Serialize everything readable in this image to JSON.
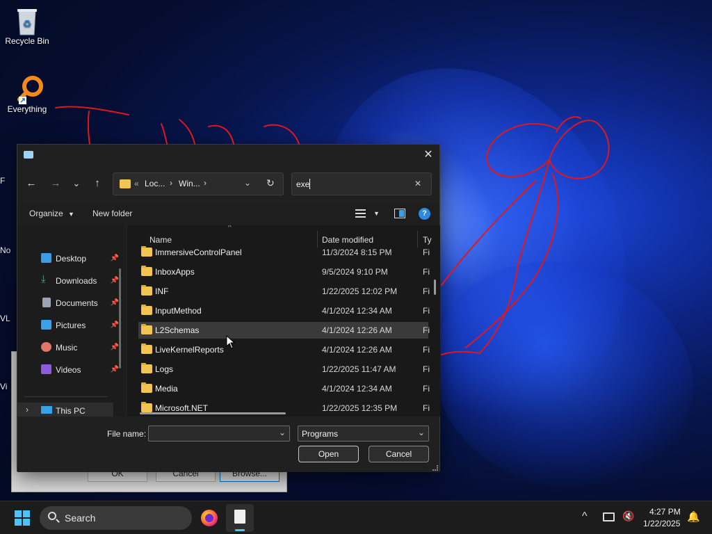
{
  "desktop": {
    "icons": [
      {
        "label": "Recycle Bin"
      },
      {
        "label": "Everything"
      }
    ],
    "partial_labels": [
      "F",
      "No",
      "VL",
      "Vi"
    ]
  },
  "background_dialog": {
    "buttons": [
      "OK",
      "Cancel",
      "Browse..."
    ]
  },
  "dialog": {
    "nav": {
      "back": "←",
      "forward": "→",
      "recent": "⌄",
      "up": "↑"
    },
    "address": {
      "prefix": "«",
      "segments": [
        "Loc...",
        "Win..."
      ],
      "sep": "›"
    },
    "search": {
      "value": "exe",
      "clear": "✕"
    },
    "toolbar": {
      "organize": "Organize",
      "new_folder": "New folder"
    },
    "nav_pane": {
      "items": [
        {
          "label": "Desktop",
          "color": "#3a9be6"
        },
        {
          "label": "Downloads",
          "color": "#4caf7a"
        },
        {
          "label": "Documents",
          "color": "#9aa4b2"
        },
        {
          "label": "Pictures",
          "color": "#3aa0e8"
        },
        {
          "label": "Music",
          "color": "#e2766b"
        },
        {
          "label": "Videos",
          "color": "#8e5ae0"
        }
      ],
      "this_pc": "This PC"
    },
    "columns": {
      "name": "Name",
      "date": "Date modified",
      "type": "Ty"
    },
    "rows": [
      {
        "name": "ImmersiveControlPanel",
        "date": "11/3/2024 8:15 PM",
        "type": "Fi"
      },
      {
        "name": "InboxApps",
        "date": "9/5/2024 9:10 PM",
        "type": "Fi"
      },
      {
        "name": "INF",
        "date": "1/22/2025 12:02 PM",
        "type": "Fi"
      },
      {
        "name": "InputMethod",
        "date": "4/1/2024 12:34 AM",
        "type": "Fi"
      },
      {
        "name": "L2Schemas",
        "date": "4/1/2024 12:26 AM",
        "type": "Fi",
        "selected": true
      },
      {
        "name": "LiveKernelReports",
        "date": "4/1/2024 12:26 AM",
        "type": "Fi"
      },
      {
        "name": "Logs",
        "date": "1/22/2025 11:47 AM",
        "type": "Fi"
      },
      {
        "name": "Media",
        "date": "4/1/2024 12:34 AM",
        "type": "Fi"
      },
      {
        "name": "Microsoft.NET",
        "date": "1/22/2025 12:35 PM",
        "type": "Fi"
      }
    ],
    "file_name": {
      "label": "File name:",
      "value": ""
    },
    "file_type": {
      "value": "Programs"
    },
    "buttons": {
      "open": "Open",
      "cancel": "Cancel"
    }
  },
  "taskbar": {
    "search_label": "Search",
    "time": "4:27 PM",
    "date": "1/22/2025"
  },
  "colors": {
    "annotation": "#e0171b",
    "accent": "#0078d4",
    "folder": "#f1c453"
  }
}
